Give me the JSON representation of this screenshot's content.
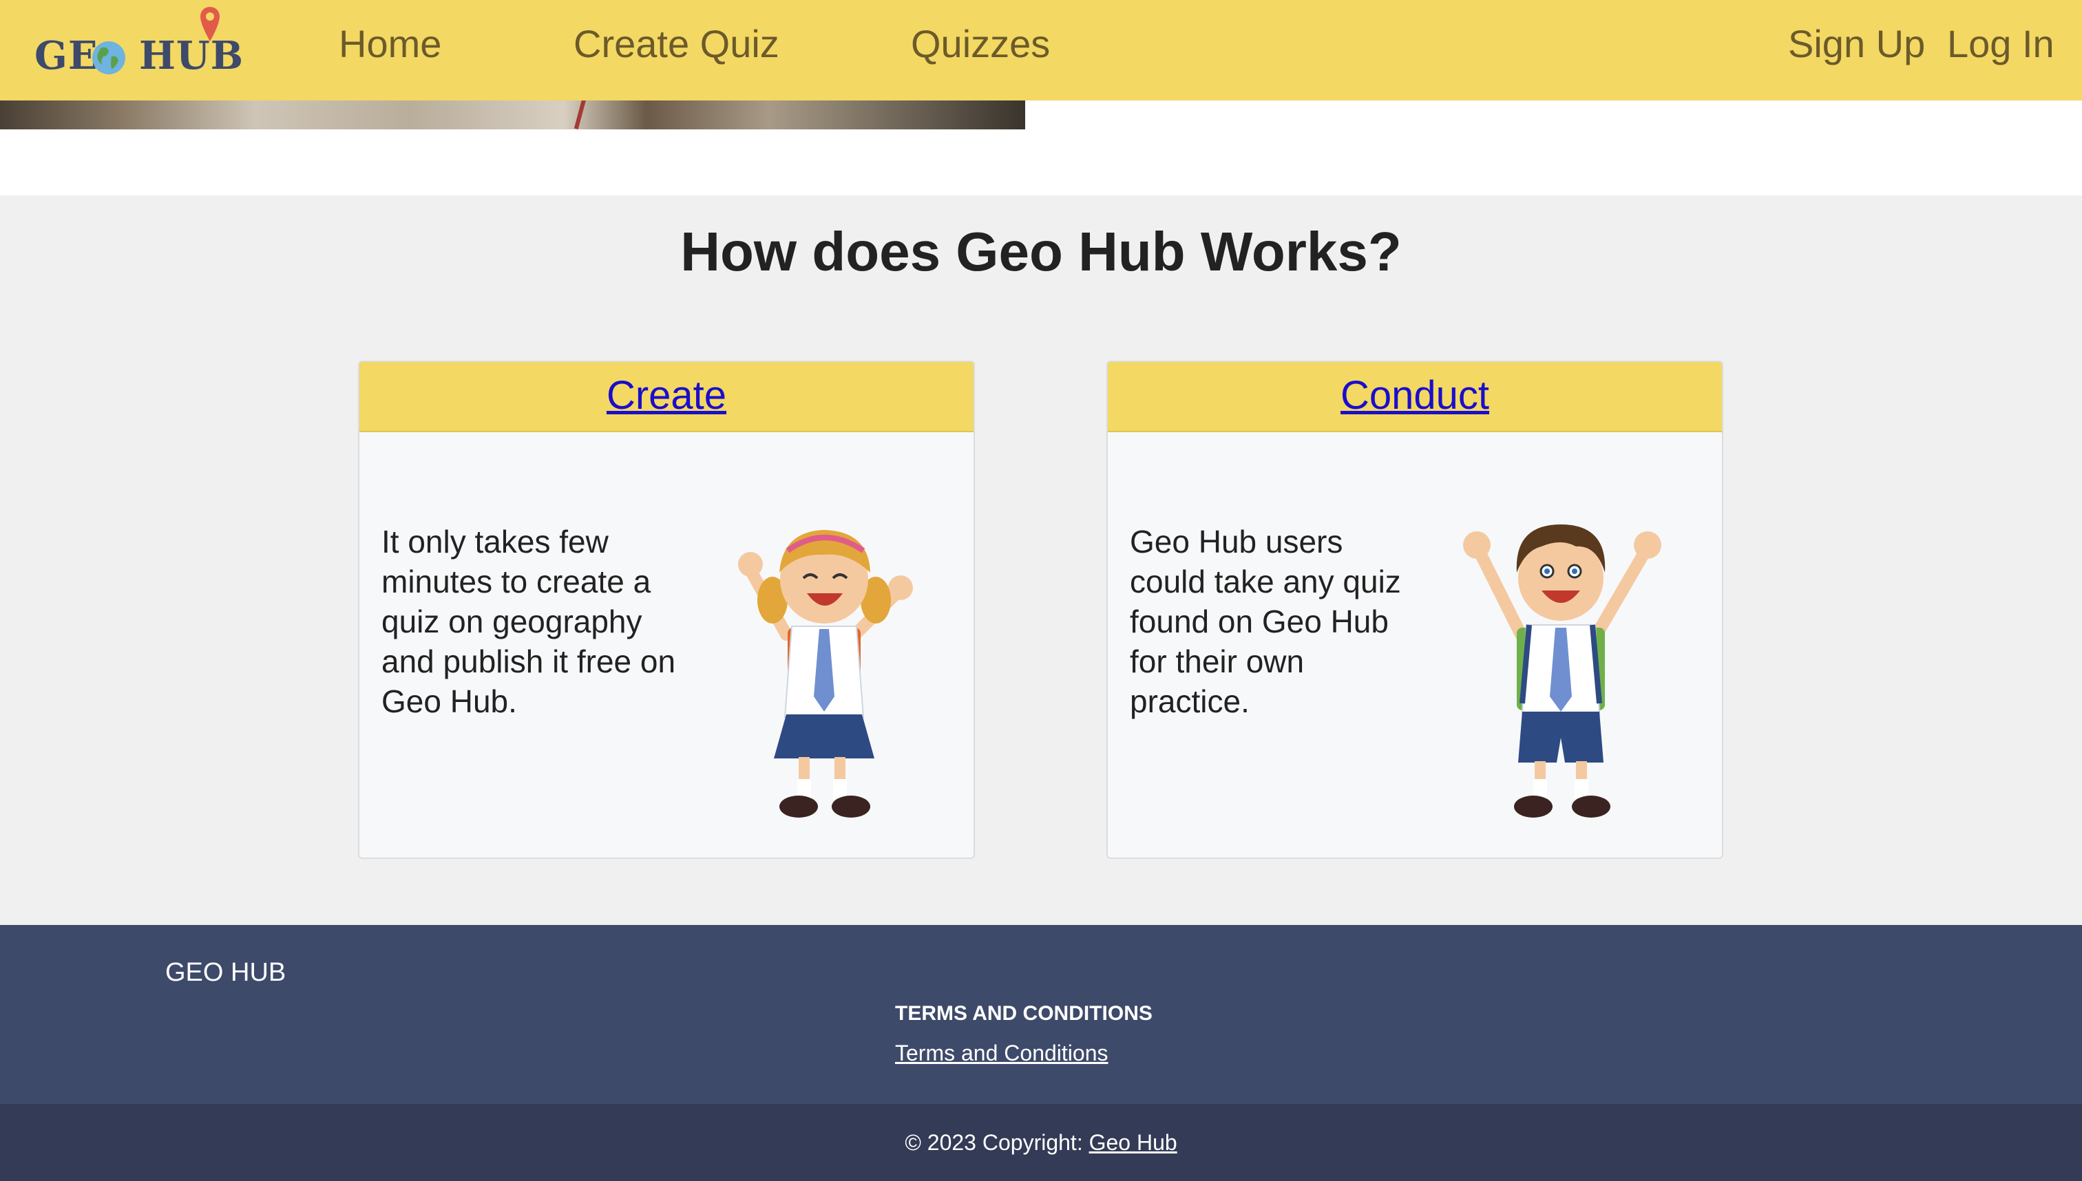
{
  "navbar": {
    "logo_left": "GE",
    "logo_right": "HUB",
    "links": [
      "Home",
      "Create Quiz",
      "Quizzes"
    ],
    "sign_up": "Sign Up",
    "log_in": "Log In",
    "background": "#f3d863"
  },
  "section": {
    "title": "How does Geo Hub Works?",
    "cards": [
      {
        "heading": "Create",
        "text": "It only takes few minutes to create a quiz on geography and publish it free on Geo Hub.",
        "image_icon": "girl-student-cheering-icon"
      },
      {
        "heading": "Conduct",
        "text": "Geo Hub users could take any quiz found on Geo Hub for their own practice.",
        "image_icon": "boy-student-cheering-icon"
      }
    ]
  },
  "footer": {
    "brand": "GEO HUB",
    "terms_heading": "TERMS AND CONDITIONS",
    "terms_link": "Terms and Conditions",
    "copyright_prefix": "© 2023 Copyright: ",
    "copyright_link": "Geo Hub",
    "background": "#3e4a6a"
  }
}
